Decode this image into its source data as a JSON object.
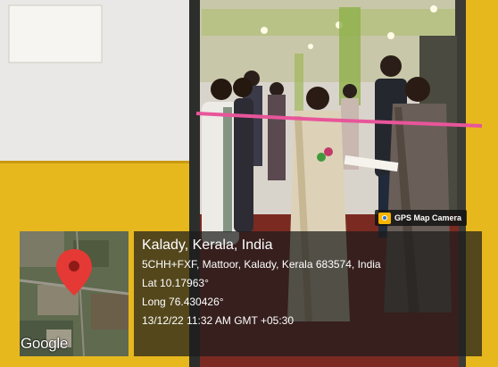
{
  "overlay": {
    "badge_label": "GPS Map Camera",
    "badge_icon": "camera-icon",
    "location_title": "Kalady, Kerala, India",
    "address": "5CHH+FXF, Mattoor, Kalady, Kerala 683574, India",
    "latitude": "Lat 10.17963°",
    "longitude": "Long 76.430426°",
    "datetime": "13/12/22 11:32 AM GMT +05:30"
  },
  "map": {
    "logo_text": "Google",
    "pin_icon": "map-pin-icon",
    "pin_color": "#e53935"
  },
  "colors": {
    "ribbon": "#e8559a",
    "wall_yellow": "#e7b81e",
    "panel_bg": "#1c1c1c"
  }
}
